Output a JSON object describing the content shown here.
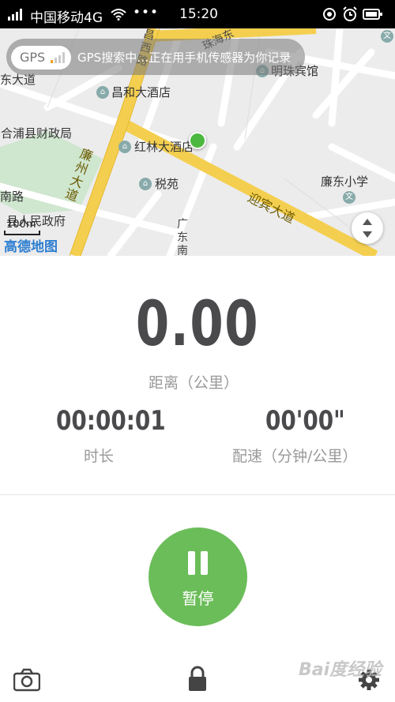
{
  "status_bar": {
    "carrier": "中国移动4G",
    "dots": "•••",
    "time": "15:20"
  },
  "map": {
    "gps_pill": "GPS",
    "gps_message": "GPS搜索中…正在用手机传感器为你记录",
    "labels": {
      "hotel_minzhu": "明珠宾馆",
      "hotel_changhe": "昌和大酒店",
      "finance_bureau": "合浦县财政局",
      "hotel_honglin": "红林大酒店",
      "tax_office": "税苑",
      "school": "廉东小学",
      "gov": "县人民政府",
      "road_east": "东大道",
      "road_south": "南路",
      "road_yingbin": "迎宾大道",
      "road_lianzhou": "廉州大道",
      "road_guangdong": "广东南",
      "road_changxi": "昌西路",
      "road_zhuhai": "珠海东"
    },
    "scale": "100m",
    "logo": "高德地图"
  },
  "stats": {
    "distance_value": "0.00",
    "distance_label": "距离（公里）",
    "duration_value": "00:00:01",
    "duration_label": "时长",
    "pace_value": "00'00\"",
    "pace_label": "配速（分钟/公里）"
  },
  "controls": {
    "pause_label": "暂停"
  },
  "colors": {
    "accent_green": "#6bbd59",
    "text_dark": "#4a4a4d",
    "text_grey": "#999999"
  },
  "watermark": "Bai度经验"
}
